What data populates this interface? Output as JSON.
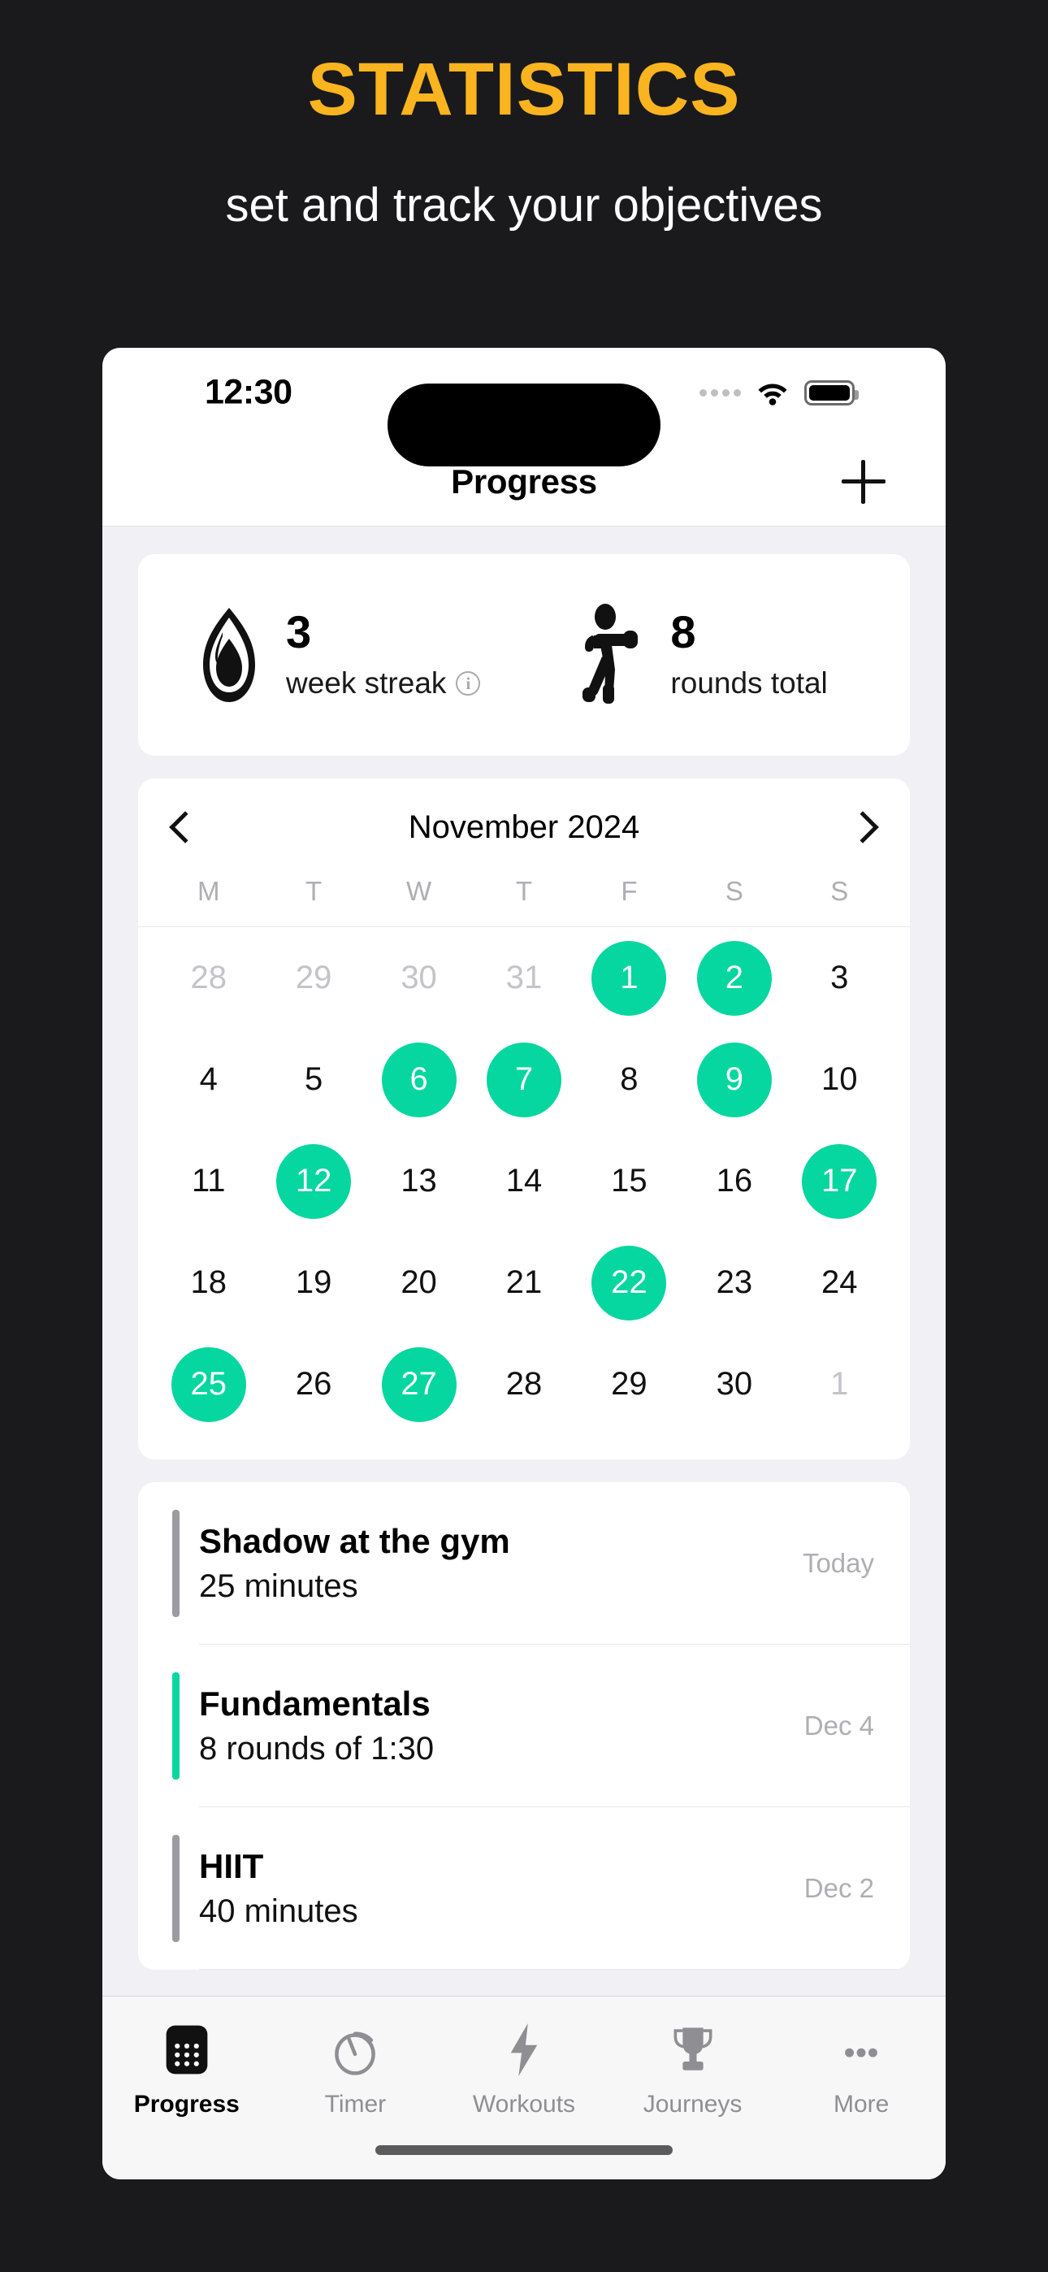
{
  "promo": {
    "title": "STATISTICS",
    "subtitle": "set and track your objectives"
  },
  "colors": {
    "accent_amber": "#F9B41F",
    "accent_green": "#06D6A0",
    "page_background": "#1A1A1C",
    "content_background": "#F1F1F5",
    "card_background": "#FFFFFF",
    "muted_text": "#AEAEB4"
  },
  "status_bar": {
    "time": "12:30",
    "cellular_icon": "cellular-dots-icon",
    "wifi_icon": "wifi-icon",
    "battery_icon": "battery-icon"
  },
  "nav_bar": {
    "title": "Progress",
    "add_icon": "plus-icon"
  },
  "stats": {
    "streak": {
      "icon": "flame-icon",
      "value": "3",
      "label": "week streak",
      "info_icon": "info-icon",
      "info_glyph": "i"
    },
    "rounds": {
      "icon": "boxer-icon",
      "value": "8",
      "label": "rounds total"
    }
  },
  "calendar": {
    "prev_icon": "chevron-left-icon",
    "next_icon": "chevron-right-icon",
    "month_label": "November 2024",
    "weekday_headers": [
      "M",
      "T",
      "W",
      "T",
      "F",
      "S",
      "S"
    ],
    "days": [
      {
        "label": "28",
        "state": "muted"
      },
      {
        "label": "29",
        "state": "muted"
      },
      {
        "label": "30",
        "state": "muted"
      },
      {
        "label": "31",
        "state": "muted"
      },
      {
        "label": "1",
        "state": "on"
      },
      {
        "label": "2",
        "state": "on"
      },
      {
        "label": "3",
        "state": "normal"
      },
      {
        "label": "4",
        "state": "normal"
      },
      {
        "label": "5",
        "state": "normal"
      },
      {
        "label": "6",
        "state": "on"
      },
      {
        "label": "7",
        "state": "on"
      },
      {
        "label": "8",
        "state": "normal"
      },
      {
        "label": "9",
        "state": "on"
      },
      {
        "label": "10",
        "state": "normal"
      },
      {
        "label": "11",
        "state": "normal"
      },
      {
        "label": "12",
        "state": "on"
      },
      {
        "label": "13",
        "state": "normal"
      },
      {
        "label": "14",
        "state": "normal"
      },
      {
        "label": "15",
        "state": "normal"
      },
      {
        "label": "16",
        "state": "normal"
      },
      {
        "label": "17",
        "state": "on"
      },
      {
        "label": "18",
        "state": "normal"
      },
      {
        "label": "19",
        "state": "normal"
      },
      {
        "label": "20",
        "state": "normal"
      },
      {
        "label": "21",
        "state": "normal"
      },
      {
        "label": "22",
        "state": "on"
      },
      {
        "label": "23",
        "state": "normal"
      },
      {
        "label": "24",
        "state": "normal"
      },
      {
        "label": "25",
        "state": "on"
      },
      {
        "label": "26",
        "state": "normal"
      },
      {
        "label": "27",
        "state": "on"
      },
      {
        "label": "28",
        "state": "normal"
      },
      {
        "label": "29",
        "state": "normal"
      },
      {
        "label": "30",
        "state": "normal"
      },
      {
        "label": "1",
        "state": "muted"
      }
    ]
  },
  "history": [
    {
      "title": "Shadow at the gym",
      "subtitle": "25 minutes",
      "date": "Today",
      "accent": "gray"
    },
    {
      "title": "Fundamentals",
      "subtitle": "8 rounds of 1:30",
      "date": "Dec 4",
      "accent": "green"
    },
    {
      "title": "HIIT",
      "subtitle": "40 minutes",
      "date": "Dec 2",
      "accent": "gray"
    }
  ],
  "tab_bar": [
    {
      "label": "Progress",
      "icon": "calendar-icon",
      "active": true
    },
    {
      "label": "Timer",
      "icon": "stopwatch-icon",
      "active": false
    },
    {
      "label": "Workouts",
      "icon": "lightning-icon",
      "active": false
    },
    {
      "label": "Journeys",
      "icon": "trophy-icon",
      "active": false
    },
    {
      "label": "More",
      "icon": "ellipsis-icon",
      "active": false
    }
  ]
}
